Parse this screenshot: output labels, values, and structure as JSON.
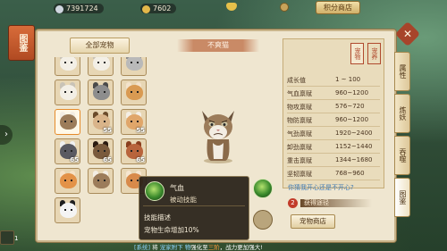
{
  "currencies": [
    {
      "icon": "silver-coin-icon",
      "value": "7391724",
      "color": "#cfd6df"
    },
    {
      "icon": "gold-pouch-icon",
      "value": "7602",
      "color": "#e3b84a"
    },
    {
      "icon": "ingot-icon",
      "value": "",
      "color": "#e6c04a"
    },
    {
      "icon": "scroll-coin-icon",
      "value": "",
      "color": "#c8a35a"
    }
  ],
  "shop_button": "积分商店",
  "book_tab": "图鉴",
  "category": "全部宠物",
  "pet_name": "不爽猫",
  "pet_grid": [
    {
      "kind": "cat-white",
      "num": ""
    },
    {
      "kind": "cat-white",
      "num": ""
    },
    {
      "kind": "cat-grey",
      "num": ""
    },
    {
      "kind": "cat-white",
      "num": ""
    },
    {
      "kind": "raccoon",
      "num": ""
    },
    {
      "kind": "corgi",
      "num": ""
    },
    {
      "kind": "cat-grumpy",
      "num": ""
    },
    {
      "kind": "pug",
      "num": "55"
    },
    {
      "kind": "cat-calico",
      "num": "55"
    },
    {
      "kind": "husky",
      "num": "65"
    },
    {
      "kind": "pug-dark",
      "num": "65"
    },
    {
      "kind": "poodle",
      "num": "65"
    },
    {
      "kind": "cat-orange",
      "num": ""
    },
    {
      "kind": "cat-grumpy",
      "num": ""
    },
    {
      "kind": "shiba",
      "num": ""
    },
    {
      "kind": "panda",
      "num": ""
    }
  ],
  "seals": [
    "宠物",
    "宠养"
  ],
  "stats": [
    {
      "label": "成长值",
      "value": "1 ~ 100"
    },
    {
      "label": "气血禀赋",
      "value": "960~1200"
    },
    {
      "label": "物攻禀赋",
      "value": "576~720"
    },
    {
      "label": "物防禀赋",
      "value": "960~1200"
    },
    {
      "label": "气劲禀赋",
      "value": "1920~2400"
    },
    {
      "label": "卸劲禀赋",
      "value": "1152~1440"
    },
    {
      "label": "重击禀赋",
      "value": "1344~1680"
    },
    {
      "label": "坚韧禀赋",
      "value": "768~960"
    }
  ],
  "question": "你猜我开心还是不开心?",
  "get_route": {
    "badge": "2",
    "label": "获得途径"
  },
  "pet_shop_button": "宠物商店",
  "right_tabs": [
    {
      "label": "属性",
      "active": false
    },
    {
      "label": "炼妖",
      "active": false
    },
    {
      "label": "吞噬",
      "active": false
    },
    {
      "label": "图鉴",
      "active": true
    }
  ],
  "tooltip": {
    "skill_name": "气血",
    "skill_type": "被动技能",
    "desc_title": "技能描述",
    "desc_text": "宠物生命增加10%"
  },
  "chat": {
    "prefix": "[系统]",
    "text": " 将 ",
    "name": "宠家附下 物",
    "mid": "强化至",
    "level": "三阶",
    "suffix": "，战力更加强大!"
  },
  "side_count": "1"
}
